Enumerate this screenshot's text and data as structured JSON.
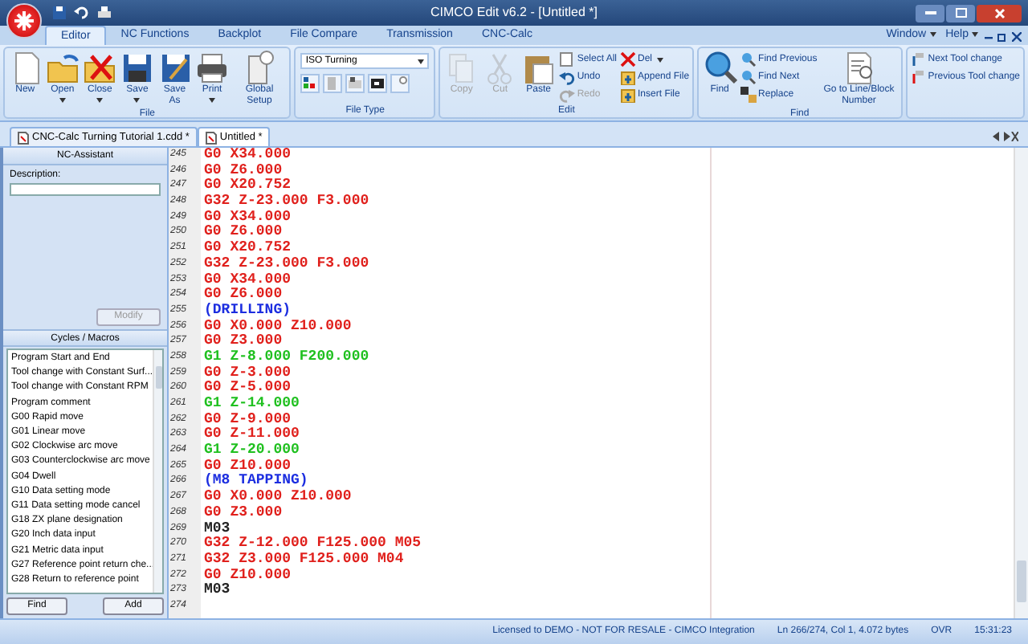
{
  "window": {
    "title": "CIMCO Edit v6.2 - [Untitled *]"
  },
  "menu_tabs": [
    {
      "label": "Editor",
      "selected": true
    },
    {
      "label": "NC Functions",
      "selected": false
    },
    {
      "label": "Backplot",
      "selected": false
    },
    {
      "label": "File Compare",
      "selected": false
    },
    {
      "label": "Transmission",
      "selected": false
    },
    {
      "label": "CNC-Calc",
      "selected": false
    }
  ],
  "right_menu": [
    "Window",
    "Help"
  ],
  "ribbon": [
    {
      "label": "File",
      "items": [
        {
          "kind": "large",
          "label": "New",
          "dropdown": false,
          "disabled": false
        },
        {
          "kind": "large",
          "label": "Open",
          "dropdown": true,
          "disabled": false
        },
        {
          "kind": "large",
          "label": "Close",
          "dropdown": true,
          "disabled": false
        },
        {
          "kind": "large",
          "label": "Save",
          "dropdown": true,
          "disabled": false
        },
        {
          "kind": "large",
          "label": "Save As",
          "dropdown": false,
          "disabled": false
        },
        {
          "kind": "large",
          "label": "Print",
          "dropdown": true,
          "disabled": false
        },
        {
          "kind": "large",
          "label": "Global Setup",
          "dropdown": false,
          "disabled": false
        }
      ]
    },
    {
      "label": "File Type",
      "items": [
        {
          "kind": "combo",
          "label": "ISO Turning"
        }
      ]
    },
    {
      "label": "Edit",
      "items": [
        {
          "kind": "large",
          "label": "Copy",
          "dropdown": false,
          "disabled": true
        },
        {
          "kind": "large",
          "label": "Cut",
          "dropdown": false,
          "disabled": true
        },
        {
          "kind": "large",
          "label": "Paste",
          "dropdown": false,
          "disabled": false
        },
        {
          "kind": "small",
          "label": "Select All",
          "dropdown": false,
          "disabled": false
        },
        {
          "kind": "small",
          "label": "Undo",
          "dropdown": false,
          "disabled": false
        },
        {
          "kind": "small",
          "label": "Redo",
          "dropdown": false,
          "disabled": true
        },
        {
          "kind": "small",
          "label": "Del",
          "dropdown": true,
          "disabled": false
        },
        {
          "kind": "small",
          "label": "Append File",
          "dropdown": false,
          "disabled": false
        },
        {
          "kind": "small",
          "label": "Insert File",
          "dropdown": false,
          "disabled": false
        }
      ]
    },
    {
      "label": "Find",
      "items": [
        {
          "kind": "large",
          "label": "Find",
          "dropdown": false,
          "disabled": false
        },
        {
          "kind": "small",
          "label": "Find Previous",
          "dropdown": false,
          "disabled": false
        },
        {
          "kind": "small",
          "label": "Find Next",
          "dropdown": false,
          "disabled": false
        },
        {
          "kind": "small",
          "label": "Replace",
          "dropdown": false,
          "disabled": false
        },
        {
          "kind": "large",
          "label": "Go to Line/Block Number",
          "dropdown": false,
          "disabled": false
        }
      ]
    },
    {
      "items": [
        {
          "kind": "small",
          "label": "Next Tool change",
          "dropdown": false,
          "disabled": false
        },
        {
          "kind": "small",
          "label": "Previous Tool change",
          "dropdown": false,
          "disabled": false
        }
      ]
    }
  ],
  "document_tabs": [
    {
      "label": "CNC-Calc Turning Tutorial 1.cdd *",
      "selected": false
    },
    {
      "label": "Untitled *",
      "selected": true
    }
  ],
  "nc_assistant": {
    "title": "NC-Assistant",
    "description_label": "Description:",
    "button": "Modify"
  },
  "cycles": {
    "title": "Cycles / Macros",
    "items": [
      "Program Start and End",
      "Tool change with Constant Surf...",
      "Tool change with Constant RPM",
      "Program comment",
      "G00 Rapid move",
      "G01 Linear move",
      "G02 Clockwise arc move",
      "G03 Counterclockwise arc move",
      "G04 Dwell",
      "G10 Data setting mode",
      "G11 Data setting mode cancel",
      "G18 ZX plane designation",
      "G20 Inch data input",
      "G21 Metric data input",
      "G27 Reference point return che...",
      "G28 Return to reference point"
    ],
    "buttons": [
      "Find",
      "Add"
    ]
  },
  "code_lines": [
    {
      "number": "245",
      "kind": "rapid",
      "text": "G0 X34.000"
    },
    {
      "number": "246",
      "kind": "rapid",
      "text": "G0 Z6.000"
    },
    {
      "number": "247",
      "kind": "rapid",
      "text": "G0 X20.752"
    },
    {
      "number": "248",
      "kind": "rapid",
      "text": "G32 Z-23.000 F3.000"
    },
    {
      "number": "249",
      "kind": "rapid",
      "text": "G0 X34.000"
    },
    {
      "number": "250",
      "kind": "rapid",
      "text": "G0 Z6.000"
    },
    {
      "number": "251",
      "kind": "rapid",
      "text": "G0 X20.752"
    },
    {
      "number": "252",
      "kind": "rapid",
      "text": "G32 Z-23.000 F3.000"
    },
    {
      "number": "253",
      "kind": "rapid",
      "text": "G0 X34.000"
    },
    {
      "number": "254",
      "kind": "rapid",
      "text": "G0 Z6.000"
    },
    {
      "number": "255",
      "kind": "comment",
      "text": "(DRILLING)"
    },
    {
      "number": "256",
      "kind": "rapid",
      "text": "G0 X0.000 Z10.000"
    },
    {
      "number": "257",
      "kind": "rapid",
      "text": "G0 Z3.000"
    },
    {
      "number": "258",
      "kind": "feed",
      "text": "G1 Z-8.000 F200.000"
    },
    {
      "number": "259",
      "kind": "rapid",
      "text": "G0 Z-3.000"
    },
    {
      "number": "260",
      "kind": "rapid",
      "text": "G0 Z-5.000"
    },
    {
      "number": "261",
      "kind": "feed",
      "text": "G1 Z-14.000"
    },
    {
      "number": "262",
      "kind": "rapid",
      "text": "G0 Z-9.000"
    },
    {
      "number": "263",
      "kind": "rapid",
      "text": "G0 Z-11.000"
    },
    {
      "number": "264",
      "kind": "feed",
      "text": "G1 Z-20.000"
    },
    {
      "number": "265",
      "kind": "rapid",
      "text": "G0 Z10.000"
    },
    {
      "number": "266",
      "kind": "comment",
      "text": "(M8 TAPPING)"
    },
    {
      "number": "267",
      "kind": "rapid",
      "text": "G0 X0.000 Z10.000"
    },
    {
      "number": "268",
      "kind": "rapid",
      "text": "G0 Z3.000"
    },
    {
      "number": "269",
      "kind": "plain",
      "text": "M03"
    },
    {
      "number": "270",
      "kind": "rapid",
      "text": "G32 Z-12.000 F125.000 M05"
    },
    {
      "number": "271",
      "kind": "rapid",
      "text": "G32 Z3.000 F125.000 M04"
    },
    {
      "number": "272",
      "kind": "rapid",
      "text": "G0 Z10.000"
    },
    {
      "number": "273",
      "kind": "plain",
      "text": "M03"
    },
    {
      "number": "274"
    }
  ],
  "status_bar": {
    "license": "Licensed to DEMO - NOT FOR RESALE - CIMCO Integration",
    "position": "Ln 266/274, Col 1, 4.072 bytes",
    "mode": "OVR",
    "time": "15:31:23"
  }
}
